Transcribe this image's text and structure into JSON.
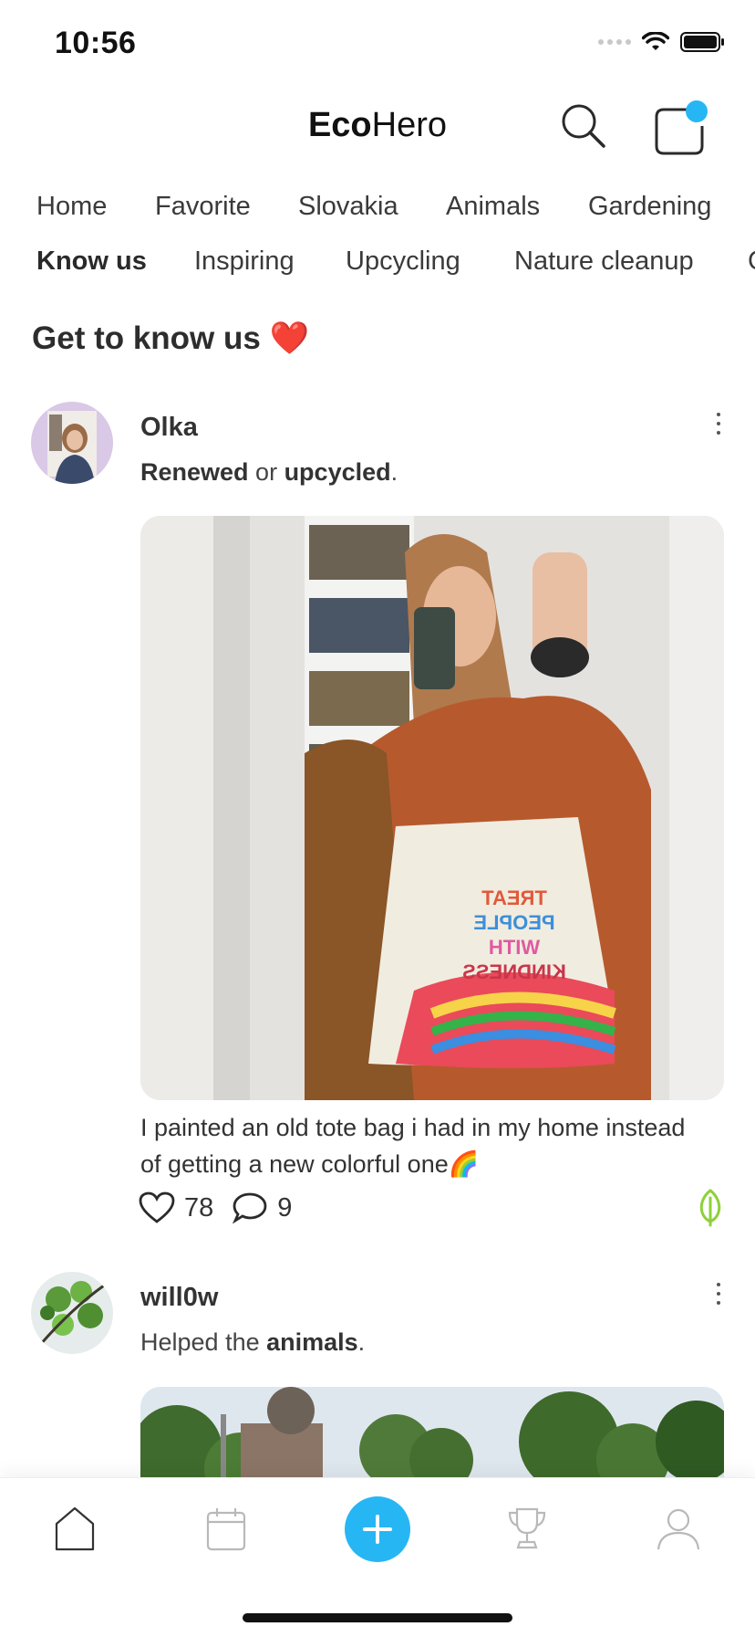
{
  "status_bar": {
    "time": "10:56"
  },
  "header": {
    "title_bold": "Eco",
    "title_light": "Hero"
  },
  "tabs_row1": [
    "Home",
    "Favorite",
    "Slovakia",
    "Animals",
    "Gardening"
  ],
  "tabs_row2": [
    "Know us",
    "Inspiring",
    "Upcycling",
    "Nature cleanup",
    "C"
  ],
  "active_tab": "Know us",
  "section": {
    "title": "Get to know us",
    "emoji": "❤️"
  },
  "posts": [
    {
      "username": "Olka",
      "activity_part1": "Renewed",
      "activity_mid": " or ",
      "activity_part2": "upcycled",
      "activity_end": ".",
      "caption": "I painted an old tote bag i had in my home instead of getting a new colorful one🌈",
      "likes": "78",
      "comments": "9",
      "bag_text": [
        "TREAT",
        "PEOPLE",
        "WITH",
        "KINDNESS"
      ]
    },
    {
      "username": "will0w",
      "activity_prefix": "Helped the ",
      "activity_bold": "animals",
      "activity_end": "."
    }
  ],
  "colors": {
    "accent": "#27b6f4",
    "leaf": "#8dd13a",
    "text": "#333333"
  },
  "icons": [
    "search-icon",
    "chat-icon",
    "home-icon",
    "calendar-icon",
    "plus-icon",
    "trophy-icon",
    "profile-icon",
    "heart-icon",
    "comment-icon",
    "leaf-icon",
    "more-icon"
  ]
}
